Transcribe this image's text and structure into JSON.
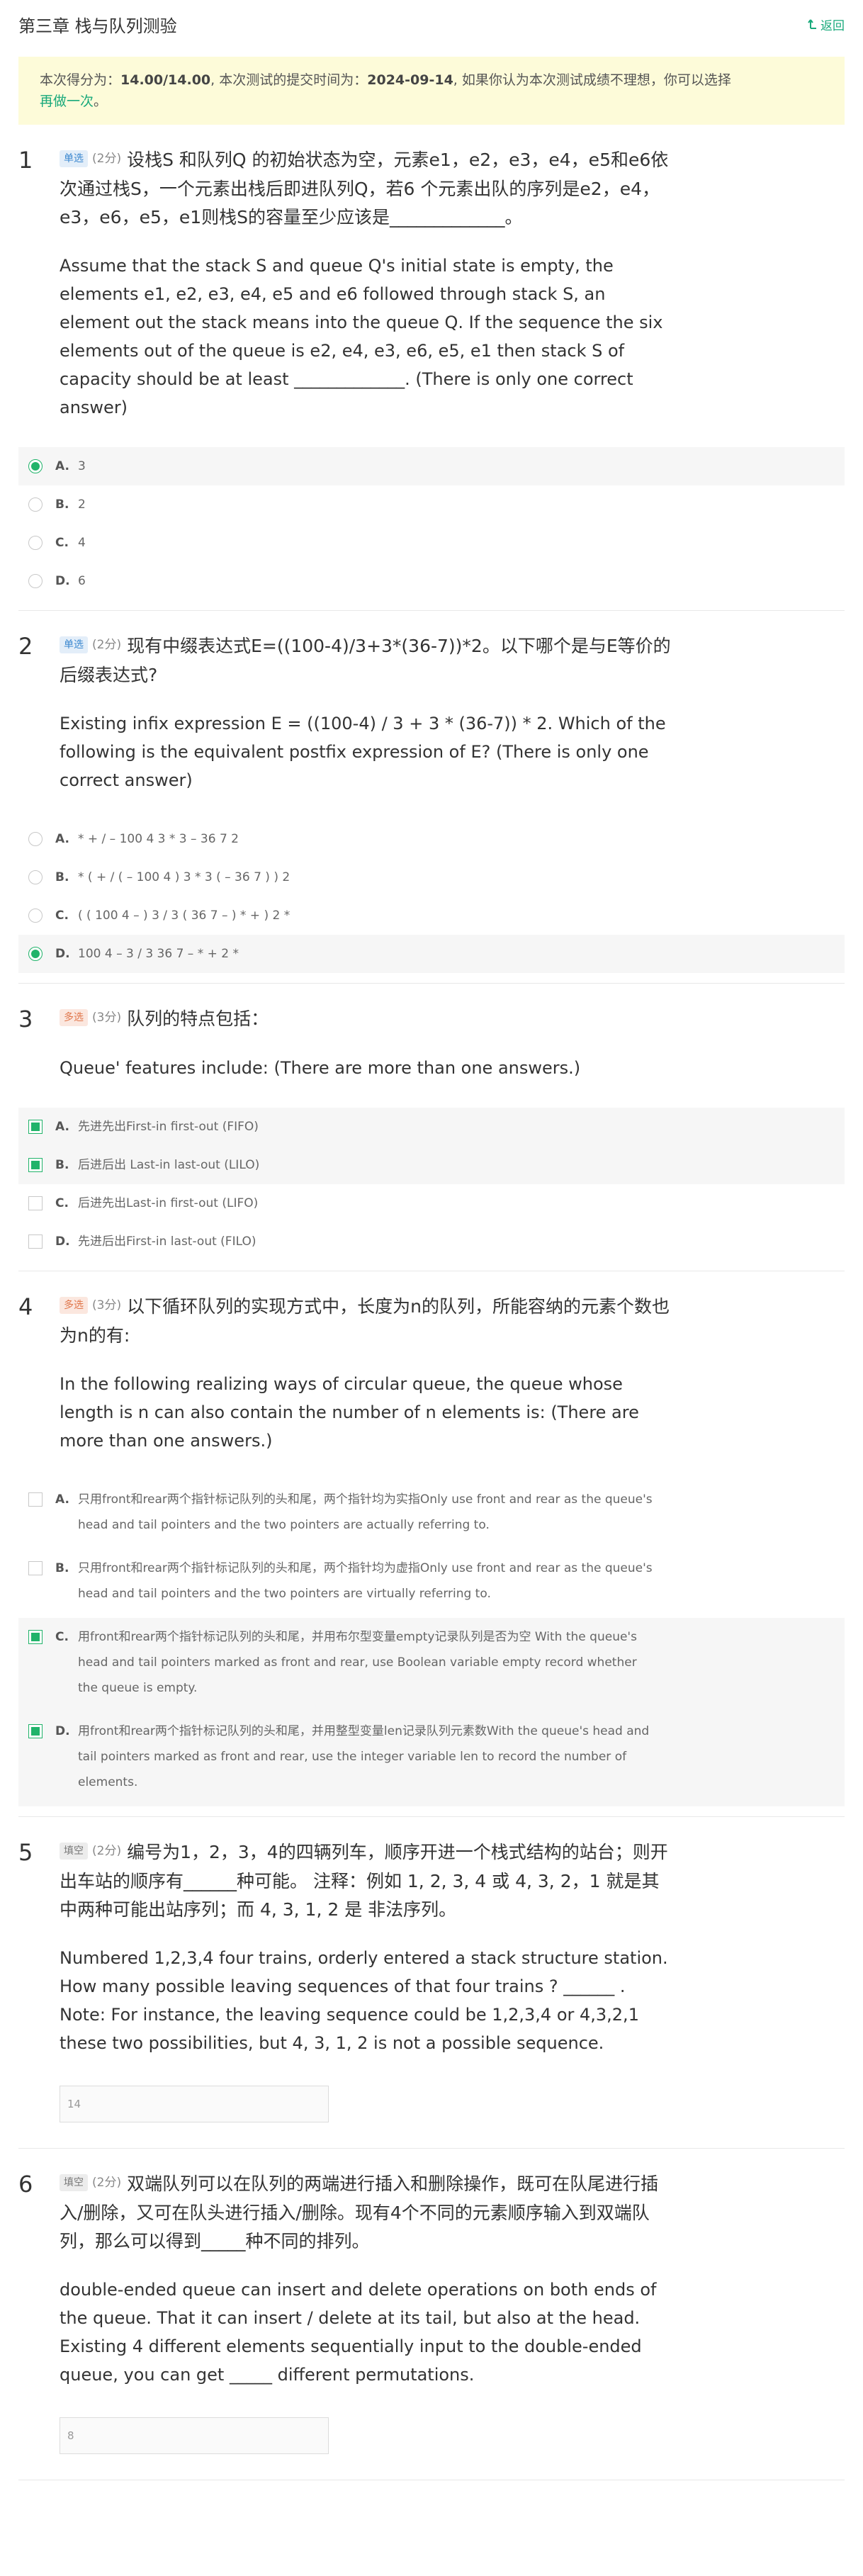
{
  "header": {
    "title": "第三章 栈与队列测验",
    "back_label": "返回"
  },
  "notice": {
    "prefix": "本次得分为：",
    "score": "14.00/14.00",
    "mid": ", 本次测试的提交时间为：",
    "date": "2024-09-14",
    "suffix": ", 如果你认为本次测试成绩不理想，你可以选择",
    "retry_label": "再做一次",
    "end": "。"
  },
  "colors": {
    "accent": "#19a97b",
    "selected": "#21b36a",
    "notice_bg": "#fdfbd9"
  },
  "questions": [
    {
      "number": "1",
      "type_label": "单选",
      "score": "(2分)",
      "title": "设栈S 和队列Q 的初始状态为空，元素e1，e2，e3，e4，e5和e6依次通过栈S，一个元素出栈后即进队列Q，若6 个元素出队的序列是e2，e4，e3，e6，e5，e1则栈S的容量至少应该是_____________。",
      "english": "Assume that the stack S and queue Q's initial state is empty, the elements e1, e2, e3, e4, e5 and e6 followed through stack S, an element out the stack means into the queue Q. If the sequence the six elements out of the queue is e2, e4, e3, e6, e5, e1 then stack S of capacity should be at least _____________.   (There is only one correct answer)",
      "options": [
        {
          "label": "A.",
          "text": "3",
          "selected": true
        },
        {
          "label": "B.",
          "text": "2",
          "selected": false
        },
        {
          "label": "C.",
          "text": "4",
          "selected": false
        },
        {
          "label": "D.",
          "text": "6",
          "selected": false
        }
      ]
    },
    {
      "number": "2",
      "type_label": "单选",
      "score": "(2分)",
      "title": "现有中缀表达式E=((100-4)/3+3*(36-7))*2。以下哪个是与E等价的后缀表达式?",
      "english": "Existing infix expression E = ((100-4) / 3 + 3 * (36-7)) * 2. Which of the following is the equivalent postfix expression of E?   (There is only one correct answer)",
      "options": [
        {
          "label": "A.",
          "text": "* + / – 100 4 3 * 3 – 36 7 2",
          "selected": false
        },
        {
          "label": "B.",
          "text": "* ( + / ( – 100 4 ) 3 * 3 ( – 36 7 ) ) 2",
          "selected": false
        },
        {
          "label": "C.",
          "text": "( ( 100 4 – ) 3 / 3 ( 36 7 – ) * + ) 2 *",
          "selected": false
        },
        {
          "label": "D.",
          "text": "100 4 – 3 / 3 36 7 – * + 2 *",
          "selected": true
        }
      ]
    },
    {
      "number": "3",
      "type_label": "多选",
      "score": "(3分)",
      "title": "队列的特点包括：",
      "english": "Queue' features include:  (There are more than one answers.)",
      "options": [
        {
          "label": "A.",
          "text": "先进先出First-in first-out (FIFO)",
          "selected": true
        },
        {
          "label": "B.",
          "text": "后进后出 Last-in last-out (LILO)",
          "selected": true
        },
        {
          "label": "C.",
          "text": "后进先出Last-in first-out (LIFO)",
          "selected": false
        },
        {
          "label": "D.",
          "text": "先进后出First-in last-out (FILO)",
          "selected": false
        }
      ]
    },
    {
      "number": "4",
      "type_label": "多选",
      "score": "(3分)",
      "title": "以下循环队列的实现方式中，长度为n的队列，所能容纳的元素个数也为n的有:",
      "english": "In the following realizing ways of circular queue, the queue whose length is n can also contain the number of n elements is:  (There are more than one answers.)",
      "options": [
        {
          "label": "A.",
          "text": "只用front和rear两个指针标记队列的头和尾，两个指针均为实指Only use front and rear as the queue's head and tail pointers and the two pointers are actually referring to.",
          "selected": false
        },
        {
          "label": "B.",
          "text": "只用front和rear两个指针标记队列的头和尾，两个指针均为虚指Only use front and rear as the queue's head and tail pointers and the two pointers are virtually referring to.",
          "selected": false
        },
        {
          "label": "C.",
          "text": "用front和rear两个指针标记队列的头和尾，并用布尔型变量empty记录队列是否为空 With the queue's head and tail pointers marked as front and rear, use Boolean variable empty record whether the queue is empty.",
          "selected": true
        },
        {
          "label": "D.",
          "text": "用front和rear两个指针标记队列的头和尾，并用整型变量len记录队列元素数With the queue's head and tail pointers marked as front and rear, use the integer variable len to record the number of elements.",
          "selected": true
        }
      ]
    },
    {
      "number": "5",
      "type_label": "填空",
      "score": "(2分)",
      "title": "编号为1，2，3，4的四辆列车，顺序开进一个栈式结构的站台；则开出车站的顺序有______种可能。 注释：例如 1, 2, 3, 4 或 4, 3, 2，1 就是其中两种可能出站序列；而 4, 3, 1, 2 是 非法序列。",
      "english": "Numbered 1,2,3,4 four trains, orderly entered a stack structure station. How many possible leaving sequences of that four trains ? ______ . Note: For instance, the leaving sequence could be 1,2,3,4 or 4,3,2,1 these two possibilities, but 4, 3, 1, 2 is not a possible sequence.",
      "answer": "14"
    },
    {
      "number": "6",
      "type_label": "填空",
      "score": "(2分)",
      "title": "双端队列可以在队列的两端进行插入和删除操作，既可在队尾进行插入/删除，又可在队头进行插入/删除。现有4个不同的元素顺序输入到双端队列，那么可以得到_____种不同的排列。",
      "english": "double-ended queue can insert and delete operations on both ends of the queue. That it can insert / delete at its tail, but also at the head. Existing 4 different elements sequentially input to the double-ended queue, you can get _____ different permutations.",
      "answer": "8"
    }
  ]
}
